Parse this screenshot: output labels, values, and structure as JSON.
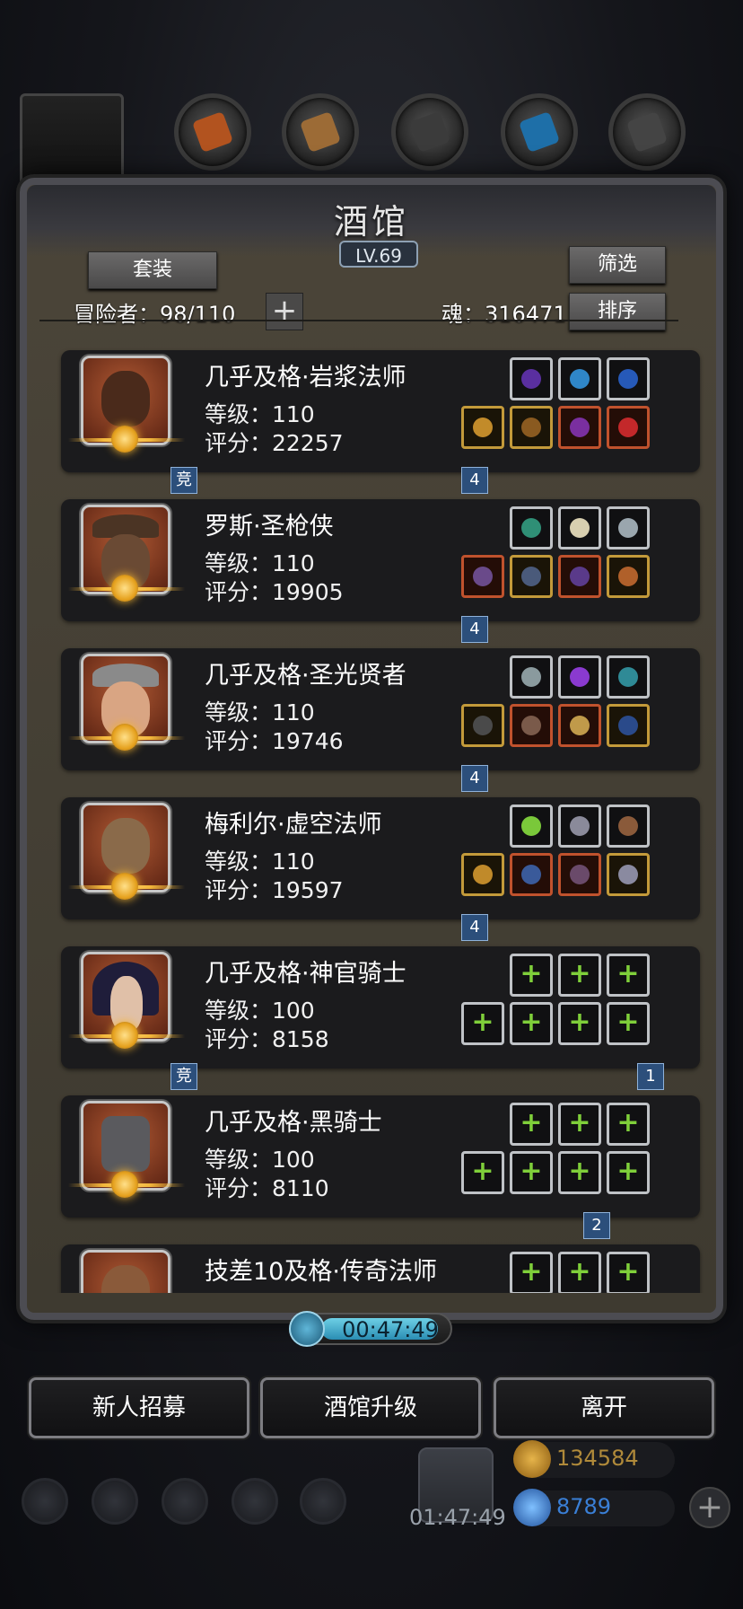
{
  "window": {
    "title": "酒馆",
    "level": "LV.69"
  },
  "header": {
    "set_button": "套装",
    "filter_button": "筛选",
    "sort_button": "排序",
    "adventurers_label": "冒险者：98/110",
    "add_symbol": "+",
    "soul_label": "魂：316471"
  },
  "heroes": [
    {
      "name": "几乎及格·岩浆法师",
      "level": "等级：110",
      "score": "评分：22257",
      "tag": "竞",
      "count": "4"
    },
    {
      "name": "罗斯·圣枪侠",
      "level": "等级：110",
      "score": "评分：19905",
      "tag": "",
      "count": "4"
    },
    {
      "name": "几乎及格·圣光贤者",
      "level": "等级：110",
      "score": "评分：19746",
      "tag": "",
      "count": "4"
    },
    {
      "name": "梅利尔·虚空法师",
      "level": "等级：110",
      "score": "评分：19597",
      "tag": "",
      "count": "4"
    },
    {
      "name": "几乎及格·神官骑士",
      "level": "等级：100",
      "score": "评分：8158",
      "tag": "竞",
      "count": "1"
    },
    {
      "name": "几乎及格·黑骑士",
      "level": "等级：100",
      "score": "评分：8110",
      "tag": "",
      "count": "2"
    },
    {
      "name": "技差10及格·传奇法师",
      "level": "",
      "score": "",
      "tag": "",
      "count": ""
    }
  ],
  "empty_slot_symbol": "+",
  "timer": "00:47:49",
  "buttons": {
    "recruit": "新人招募",
    "upgrade": "酒馆升级",
    "leave": "离开"
  },
  "footer": {
    "gift_timer": "01:47:49",
    "gold": "134584",
    "gems": "8789",
    "plus": "+"
  },
  "colors": {
    "accent_gold": "#f3b73b",
    "gold_text": "#b08a3a",
    "gem_text": "#3a7fd6",
    "timer_fill": "#2a8db3"
  }
}
